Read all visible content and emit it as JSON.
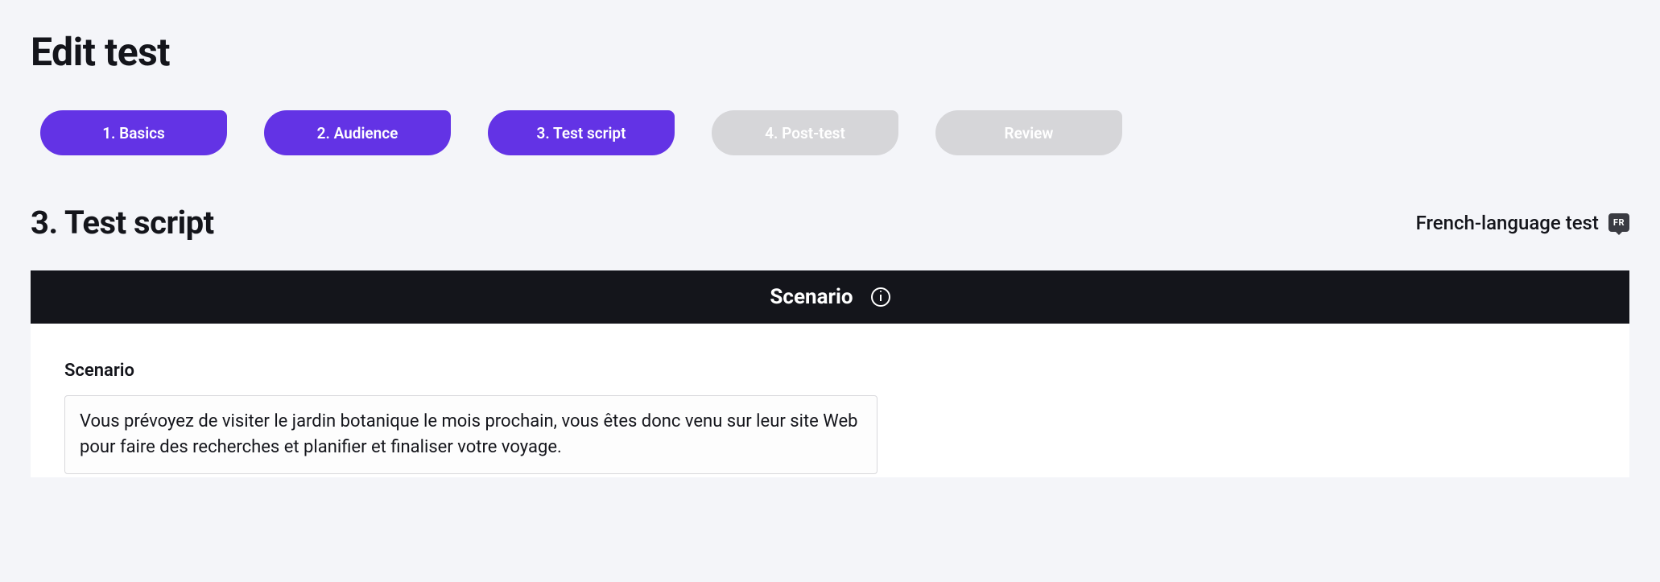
{
  "header": {
    "title": "Edit test"
  },
  "steps": [
    {
      "label": "1. Basics",
      "active": true
    },
    {
      "label": "2. Audience",
      "active": true
    },
    {
      "label": "3. Test script",
      "active": true
    },
    {
      "label": "4. Post-test",
      "active": false
    },
    {
      "label": "Review",
      "active": false
    }
  ],
  "section": {
    "title": "3. Test script",
    "language_text": "French-language test",
    "language_badge": "FR"
  },
  "scenario": {
    "header_title": "Scenario",
    "field_label": "Scenario",
    "value": "Vous prévoyez de visiter le jardin botanique le mois prochain, vous êtes donc venu sur leur site Web pour faire des recherches et planifier et finaliser votre voyage."
  },
  "colors": {
    "accent": "#6333e5",
    "inactive": "#d6d6d9",
    "dark": "#14151b",
    "bg": "#f4f5f9"
  }
}
